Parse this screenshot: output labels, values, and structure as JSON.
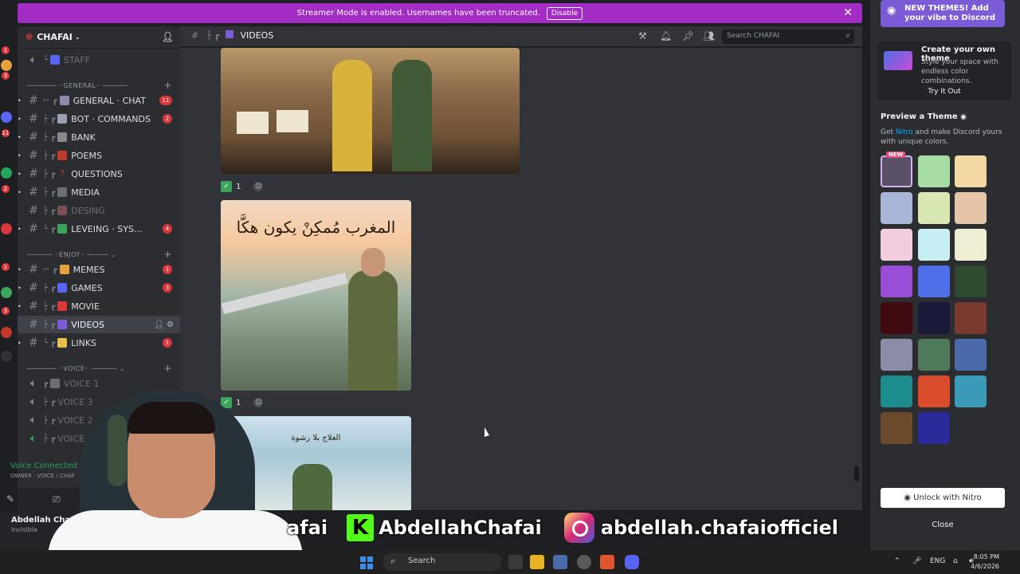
{
  "banner": {
    "text": "Streamer Mode is enabled. Usernames have been truncated.",
    "disable_label": "Disable"
  },
  "guild": {
    "name": "CHAFAI"
  },
  "channels": {
    "staff": "STAFF",
    "cat_general": "GENERAL",
    "general_chat": "GENERAL · CHAT",
    "general_chat_badge": "11",
    "bot_commands": "BOT · COMMANDS",
    "bot_commands_badge": "2",
    "bank": "BANK",
    "poems": "POEMS",
    "questions": "QUESTIONS",
    "media": "MEDIA",
    "desing": "DESING",
    "leveing": "LEVEING · SYS...",
    "leveing_badge": "4",
    "cat_enjoy": "ENJOY",
    "memes": "MEMES",
    "memes_badge": "1",
    "games": "GAMES",
    "games_badge": "3",
    "movie": "MOVIE",
    "videos": "VIDEOS",
    "links": "LINKS",
    "links_badge": "1",
    "cat_voice": "VOICE",
    "voice1": "VOICE 1",
    "voice3": "VOICE 3",
    "voice2": "VOICE 2",
    "voice4": "VOICE 4"
  },
  "voice_status": {
    "connected": "Voice Connected",
    "location": "OWNER · VOICE / CHAF"
  },
  "user": {
    "name": "Abdellah Chafai (...",
    "status": "Invisible"
  },
  "chat_header": {
    "title": "VIDEOS",
    "search_placeholder": "Search CHAFAI"
  },
  "messages": {
    "reaction_count_1": "1",
    "reaction_count_2": "1",
    "img2_caption": "المغرب مُمكِنْ يكون هكَّا",
    "img3_caption": "العلاج بلا رشوة"
  },
  "right_panel": {
    "promo": "NEW THEMES! Add your vibe to Discord",
    "create_title": "Create your own theme",
    "create_desc": "Style your space with endless color combinations.",
    "try_label": "Try It Out",
    "preview_title": "Preview a Theme",
    "preview_desc_1": "Get ",
    "preview_desc_link": "Nitro",
    "preview_desc_2": " and make Discord yours with unique colors.",
    "new_tag": "NEW",
    "unlock_label": "Unlock with Nitro",
    "close_label": "Close",
    "swatches": [
      "#5a5068",
      "#a6dca6",
      "#f2d8a2",
      "#a8b6d8",
      "#d7e8b2",
      "#e6c4a8",
      "#f2cde0",
      "#c7eef2",
      "#eeeed2",
      "#9a4ed8",
      "#4f6fe8",
      "#2f4a2f",
      "#400a10",
      "#1b1a3a",
      "#7a3a30",
      "#8a8ca8",
      "#4e7a5a",
      "#4a6aaa",
      "#1c8c8c",
      "#d84c2c",
      "#3a9ab8",
      "#6a4a2a",
      "#2a2a9a"
    ]
  },
  "social": {
    "handle_cut": "afai",
    "kick_handle": "AbdellahChafai",
    "ig_handle": "abdellah.chafaiofficiel"
  },
  "taskbar": {
    "search_label": "Search",
    "lang": "ENG",
    "time": "8:05 PM",
    "date": "4/6/2026"
  }
}
